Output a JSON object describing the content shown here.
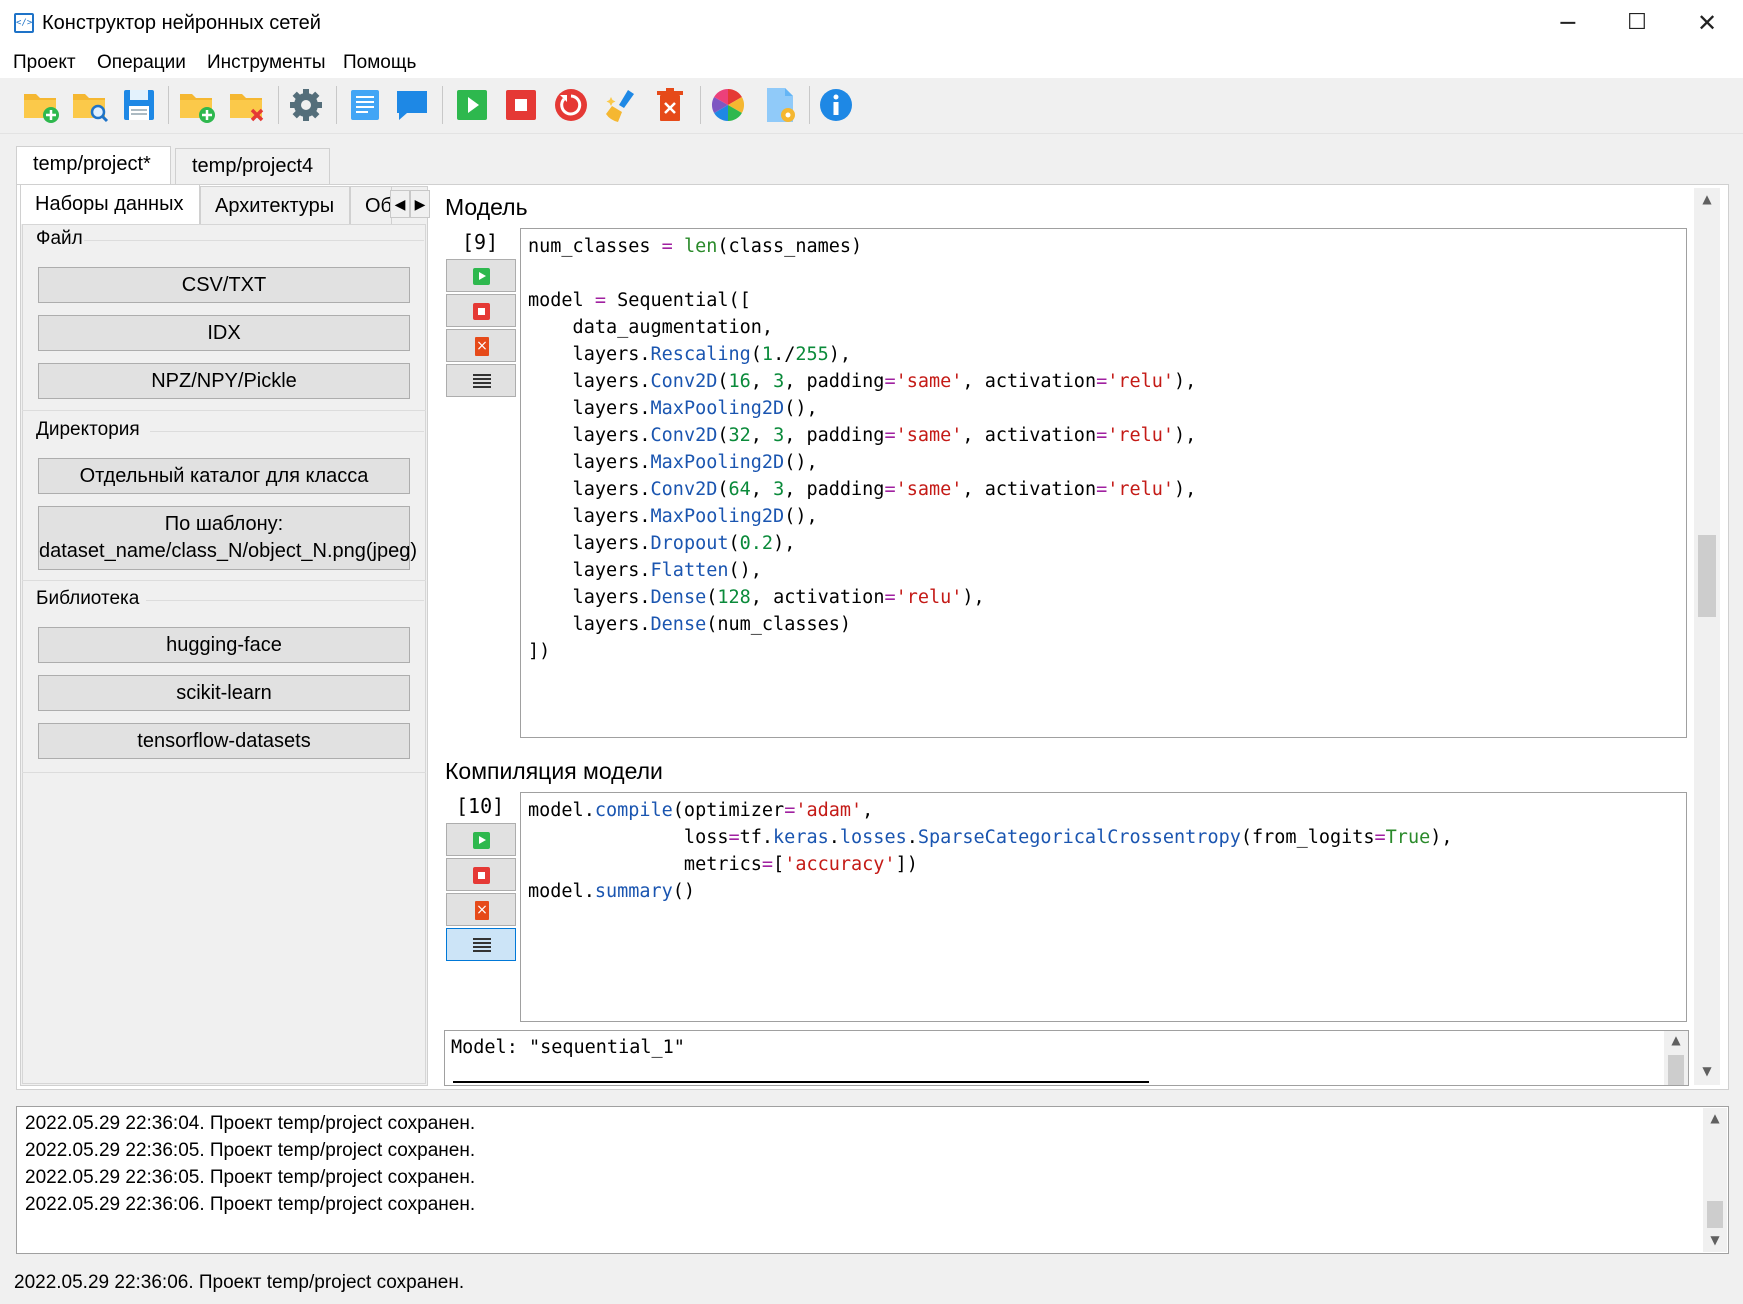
{
  "window": {
    "title": "Конструктор нейронных сетей",
    "app_icon": "</>",
    "minimize_glyph": "─",
    "maximize_glyph": "☐",
    "close_glyph": "✕"
  },
  "menu": [
    "Проект",
    "Операции",
    "Инструменты",
    "Помощь"
  ],
  "toolbar": {
    "icons": [
      "new-folder-icon",
      "open-folder-icon",
      "save-icon",
      "add-folder-icon",
      "delete-folder-icon",
      "settings-gear-icon",
      "document-icon",
      "comment-icon",
      "run-icon",
      "stop-icon",
      "restart-icon",
      "clean-brush-icon",
      "delete-icon",
      "color-palette-icon",
      "file-settings-icon",
      "info-icon"
    ],
    "colors": {
      "folder": "#f5b731",
      "blue": "#1e88e5",
      "green": "#2eb84e",
      "red": "#e53935",
      "orange": "#e64a19"
    }
  },
  "project_tabs": [
    "temp/project*",
    "temp/project4"
  ],
  "left_panel": {
    "tabs": [
      "Наборы данных",
      "Архитектуры",
      "Об"
    ],
    "groups": [
      {
        "title": "Файл",
        "buttons": [
          "CSV/TXT",
          "IDX",
          "NPZ/NPY/Pickle"
        ]
      },
      {
        "title": "Директория",
        "buttons": [
          "Отдельный каталог для класса",
          "По шаблону:",
          "dataset_name/class_N/object_N.png(jpeg)"
        ]
      },
      {
        "title": "Библиотека",
        "buttons": [
          "hugging-face",
          "scikit-learn",
          "tensorflow-datasets"
        ]
      }
    ]
  },
  "cells": [
    {
      "title": "Модель",
      "number": "[9]",
      "code": [
        "num_classes = len(class_names)",
        "",
        "model = Sequential([",
        "    data_augmentation,",
        "    layers.Rescaling(1./255),",
        "    layers.Conv2D(16, 3, padding='same', activation='relu'),",
        "    layers.MaxPooling2D(),",
        "    layers.Conv2D(32, 3, padding='same', activation='relu'),",
        "    layers.MaxPooling2D(),",
        "    layers.Conv2D(64, 3, padding='same', activation='relu'),",
        "    layers.MaxPooling2D(),",
        "    layers.Dropout(0.2),",
        "    layers.Flatten(),",
        "    layers.Dense(128, activation='relu'),",
        "    layers.Dense(num_classes)",
        "])"
      ]
    },
    {
      "title": "Компиляция модели",
      "number": "[10]",
      "code": [
        "model.compile(optimizer='adam',",
        "              loss=tf.keras.losses.SparseCategoricalCrossentropy(from_logits=True),",
        "              metrics=['accuracy'])",
        "model.summary()"
      ],
      "output": "Model: \"sequential_1\""
    }
  ],
  "log": [
    "2022.05.29 22:36:04. Проект temp/project сохранен.",
    "2022.05.29 22:36:05. Проект temp/project сохранен.",
    "2022.05.29 22:36:05. Проект temp/project сохранен.",
    "2022.05.29 22:36:06. Проект temp/project сохранен."
  ],
  "status": "2022.05.29 22:36:06. Проект temp/project сохранен."
}
